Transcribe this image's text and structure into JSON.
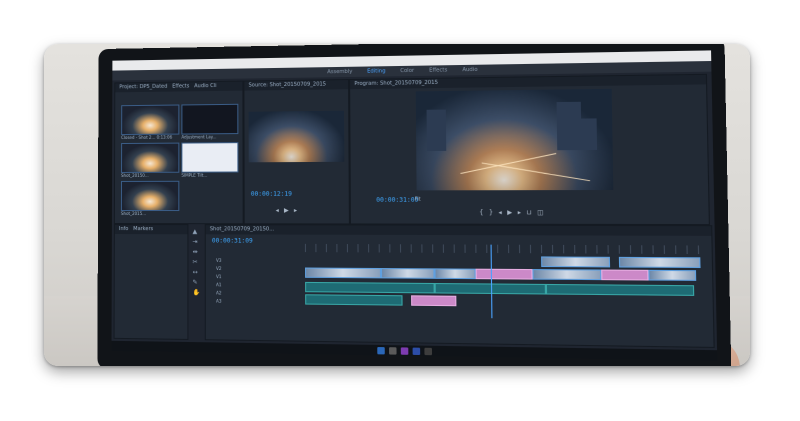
{
  "workspace_tabs": [
    "Assembly",
    "Editing",
    "Color",
    "Effects",
    "Audio"
  ],
  "active_tab": "Editing",
  "project_panel": {
    "title": "Project: DP5_Dated",
    "tabs": [
      "Effects",
      "Audio Cli"
    ],
    "items": [
      {
        "label": "Closed - Shot 2...",
        "duration": "0:13:06",
        "thumb": "traffic"
      },
      {
        "label": "Adjustment Lay...",
        "duration": "0:05:22",
        "thumb": "dark"
      },
      {
        "label": "Shot_20150...",
        "duration": "0:15",
        "thumb": "traffic"
      },
      {
        "label": "SIMPLE Tilt...",
        "duration": "0:10:30",
        "thumb": "white"
      },
      {
        "label": "Shot_2015...",
        "duration": "5:00:00",
        "thumb": "traffic"
      }
    ]
  },
  "source_monitor": {
    "title": "Source: Shot_20150709_2015",
    "timecode": "00:00:12:19"
  },
  "program_monitor": {
    "title": "Program: Shot_20150709_2015",
    "timecode": "00:00:31:09",
    "zoom": "Fit"
  },
  "lower_left_tabs": [
    "Info",
    "Markers"
  ],
  "timeline": {
    "title": "Shot_20150709_20150...",
    "timecode": "00:00:31:09",
    "tracks": [
      "V3",
      "V2",
      "V1",
      "A1",
      "A2",
      "A3"
    ]
  },
  "colors": {
    "accent": "#4aa3ff",
    "panel_bg": "#222a35",
    "clip_video": "#8aa0bb",
    "clip_audio": "#1e6b74",
    "clip_pink": "#cc89c8"
  }
}
